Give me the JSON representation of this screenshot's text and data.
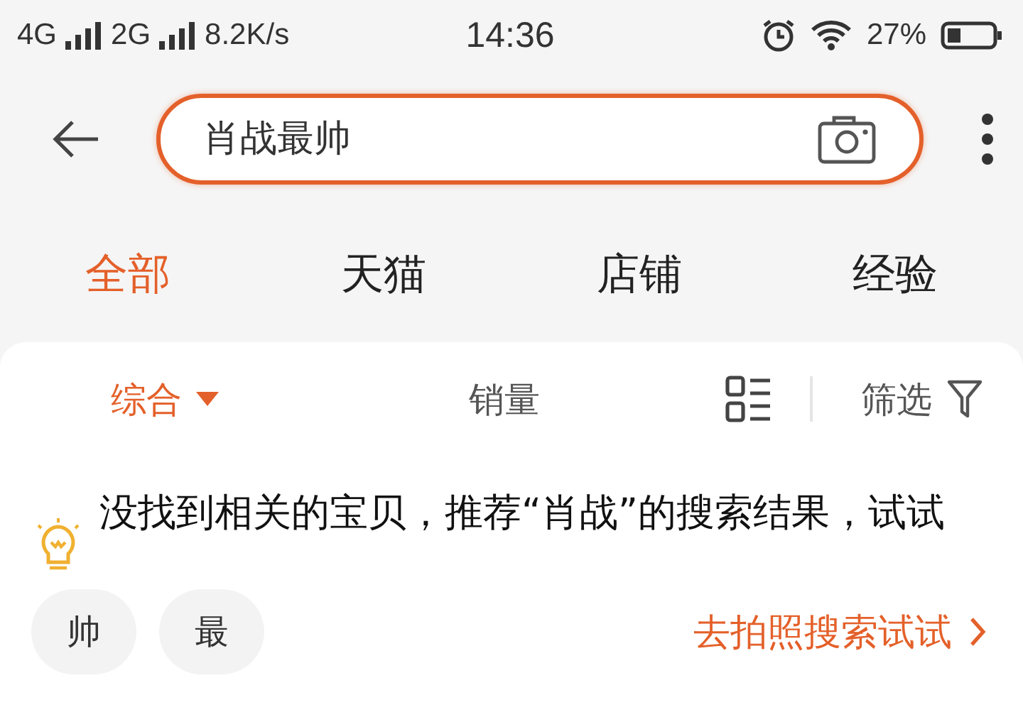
{
  "status_bar": {
    "networks": [
      "4G",
      "2G"
    ],
    "speed": "8.2K/s",
    "time": "14:36",
    "battery": "27%"
  },
  "search": {
    "value": "肖战最帅"
  },
  "tabs": [
    {
      "label": "全部",
      "selected": true
    },
    {
      "label": "天猫",
      "selected": false
    },
    {
      "label": "店铺",
      "selected": false
    },
    {
      "label": "经验",
      "selected": false
    }
  ],
  "sort_bar": [
    {
      "label": "综合",
      "kind": "dropdown",
      "selected": true
    },
    {
      "label": "销量",
      "kind": "plain",
      "selected": false
    },
    {
      "label": "筛选",
      "kind": "filter",
      "selected": false
    }
  ],
  "notice": "没找到相关的宝贝，推荐“肖战”的搜索结果，试试",
  "suggestions": [
    "帅",
    "最"
  ],
  "photo_search_link": "去拍照搜索试试"
}
